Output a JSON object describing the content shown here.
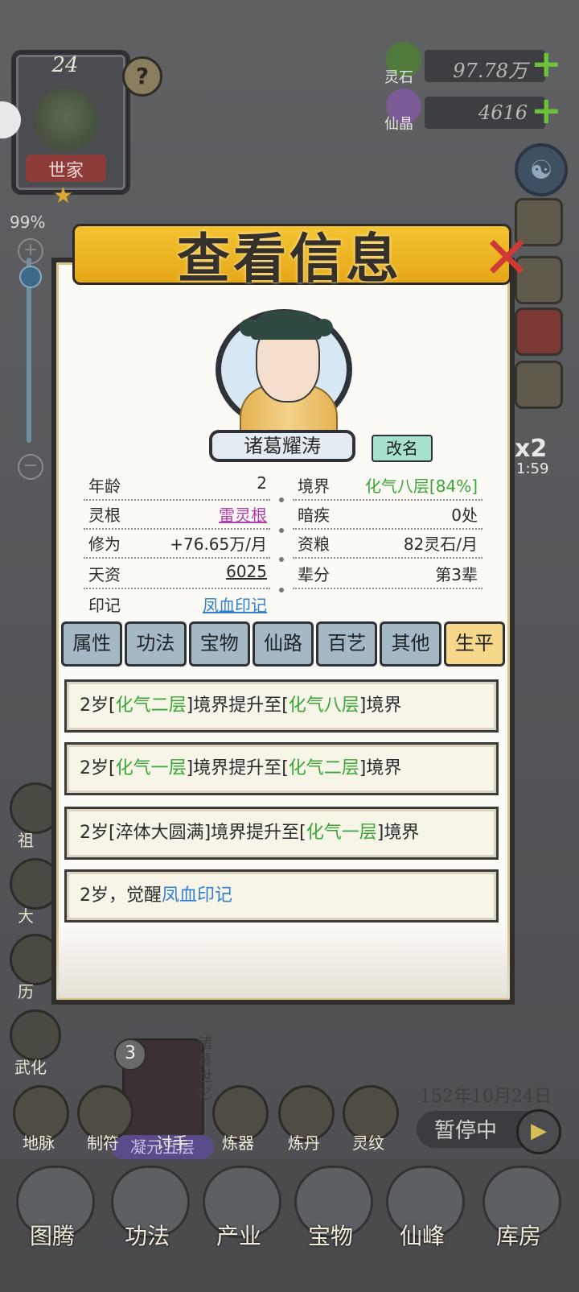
{
  "clan": {
    "level": "24",
    "name": "世家",
    "help_icon": "?"
  },
  "zoom": {
    "percent": "99%",
    "plus": "+",
    "minus": "−",
    "level": 0.99
  },
  "resources": [
    {
      "label": "灵石",
      "value": "97.78万",
      "icon": "spirit-stone-icon"
    },
    {
      "label": "仙晶",
      "value": "4616",
      "icon": "immortal-crystal-icon"
    }
  ],
  "dialog": {
    "title": "查看信息",
    "character_name": "诸葛耀涛",
    "rename_label": "改名",
    "left_rows": [
      {
        "label": "年龄",
        "value": "2"
      },
      {
        "label": "灵根",
        "value": "雷灵根"
      },
      {
        "label": "修为",
        "value": "+76.65万/月"
      },
      {
        "label": "天资",
        "value": "6025"
      },
      {
        "label": "印记",
        "value": "凤血印记"
      }
    ],
    "right_rows": [
      {
        "label": "境界",
        "value": "化气八层[84%]"
      },
      {
        "label": "暗疾",
        "value": "0处"
      },
      {
        "label": "资粮",
        "value": "82灵石/月"
      },
      {
        "label": "辈分",
        "value": "第3辈"
      }
    ],
    "tabs": [
      "属性",
      "功法",
      "宝物",
      "仙路",
      "百艺",
      "其他",
      "生平"
    ],
    "active_tab": "生平",
    "events": [
      {
        "a": "2岁[",
        "b": "化气二层",
        "c": "]境界提升至[",
        "d": "化气八层",
        "e": "]境界"
      },
      {
        "a": "2岁[",
        "b": "化气一层",
        "c": "]境界提升至[",
        "d": "化气二层",
        "e": "]境界"
      },
      {
        "a": "2岁[淬体大圆满]境界提升至[",
        "b": "化气一层",
        "c": "]境界"
      },
      {
        "a": "2岁，觉醒",
        "b": "凤血印记"
      }
    ]
  },
  "right_side": {
    "speed": "x2",
    "timer": "1:59"
  },
  "left_side_labels": [
    "祖",
    "大",
    "历",
    "武化"
  ],
  "portrait": {
    "badge": "3",
    "tag": "诸葛世忆",
    "realm": "凝元五层"
  },
  "date": "152年10月24日",
  "pause_label": "暂停中",
  "mid_buttons": [
    "地脉",
    "制符",
    "讨手",
    "炼器",
    "炼丹",
    "灵纹"
  ],
  "bottom_nav": [
    "图腾",
    "功法",
    "产业",
    "宝物",
    "仙峰",
    "库房"
  ]
}
